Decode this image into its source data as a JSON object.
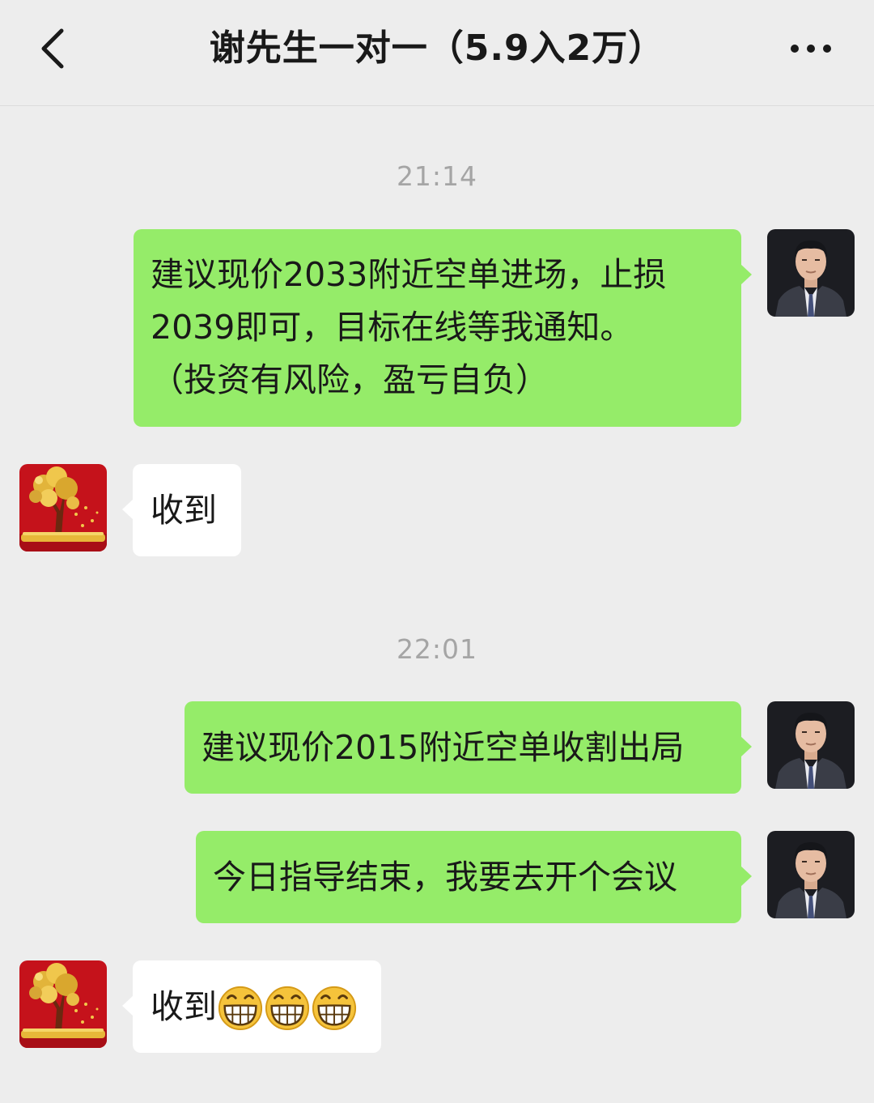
{
  "header": {
    "title": "谢先生一对一（5.9入2万）",
    "back_icon": "chevron-left-icon",
    "more_icon": "more-dots-icon"
  },
  "messages": [
    {
      "type": "time",
      "text": "21:14"
    },
    {
      "type": "msg",
      "side": "out",
      "sender_avatar": "man-portrait-avatar",
      "lines": [
        "建议现价2033附近空单进场，止损",
        "2039即可，目标在线等我通知。",
        "（投资有风险，盈亏自负）"
      ]
    },
    {
      "type": "msg",
      "side": "in",
      "sender_avatar": "golden-tree-avatar",
      "text": "收到"
    },
    {
      "type": "time",
      "text": "22:01"
    },
    {
      "type": "msg",
      "side": "out",
      "sender_avatar": "man-portrait-avatar",
      "text": "建议现价2015附近空单收割出局"
    },
    {
      "type": "msg",
      "side": "out",
      "sender_avatar": "man-portrait-avatar",
      "text": "今日指导结束，我要去开个会议"
    },
    {
      "type": "msg",
      "side": "in",
      "sender_avatar": "golden-tree-avatar",
      "text": "收到",
      "emoji": [
        "grin-emoji",
        "grin-emoji",
        "grin-emoji"
      ]
    }
  ],
  "colors": {
    "background": "#ededed",
    "outgoing_bubble": "#95ec69",
    "incoming_bubble": "#ffffff",
    "timestamp": "#a5a5a5"
  }
}
